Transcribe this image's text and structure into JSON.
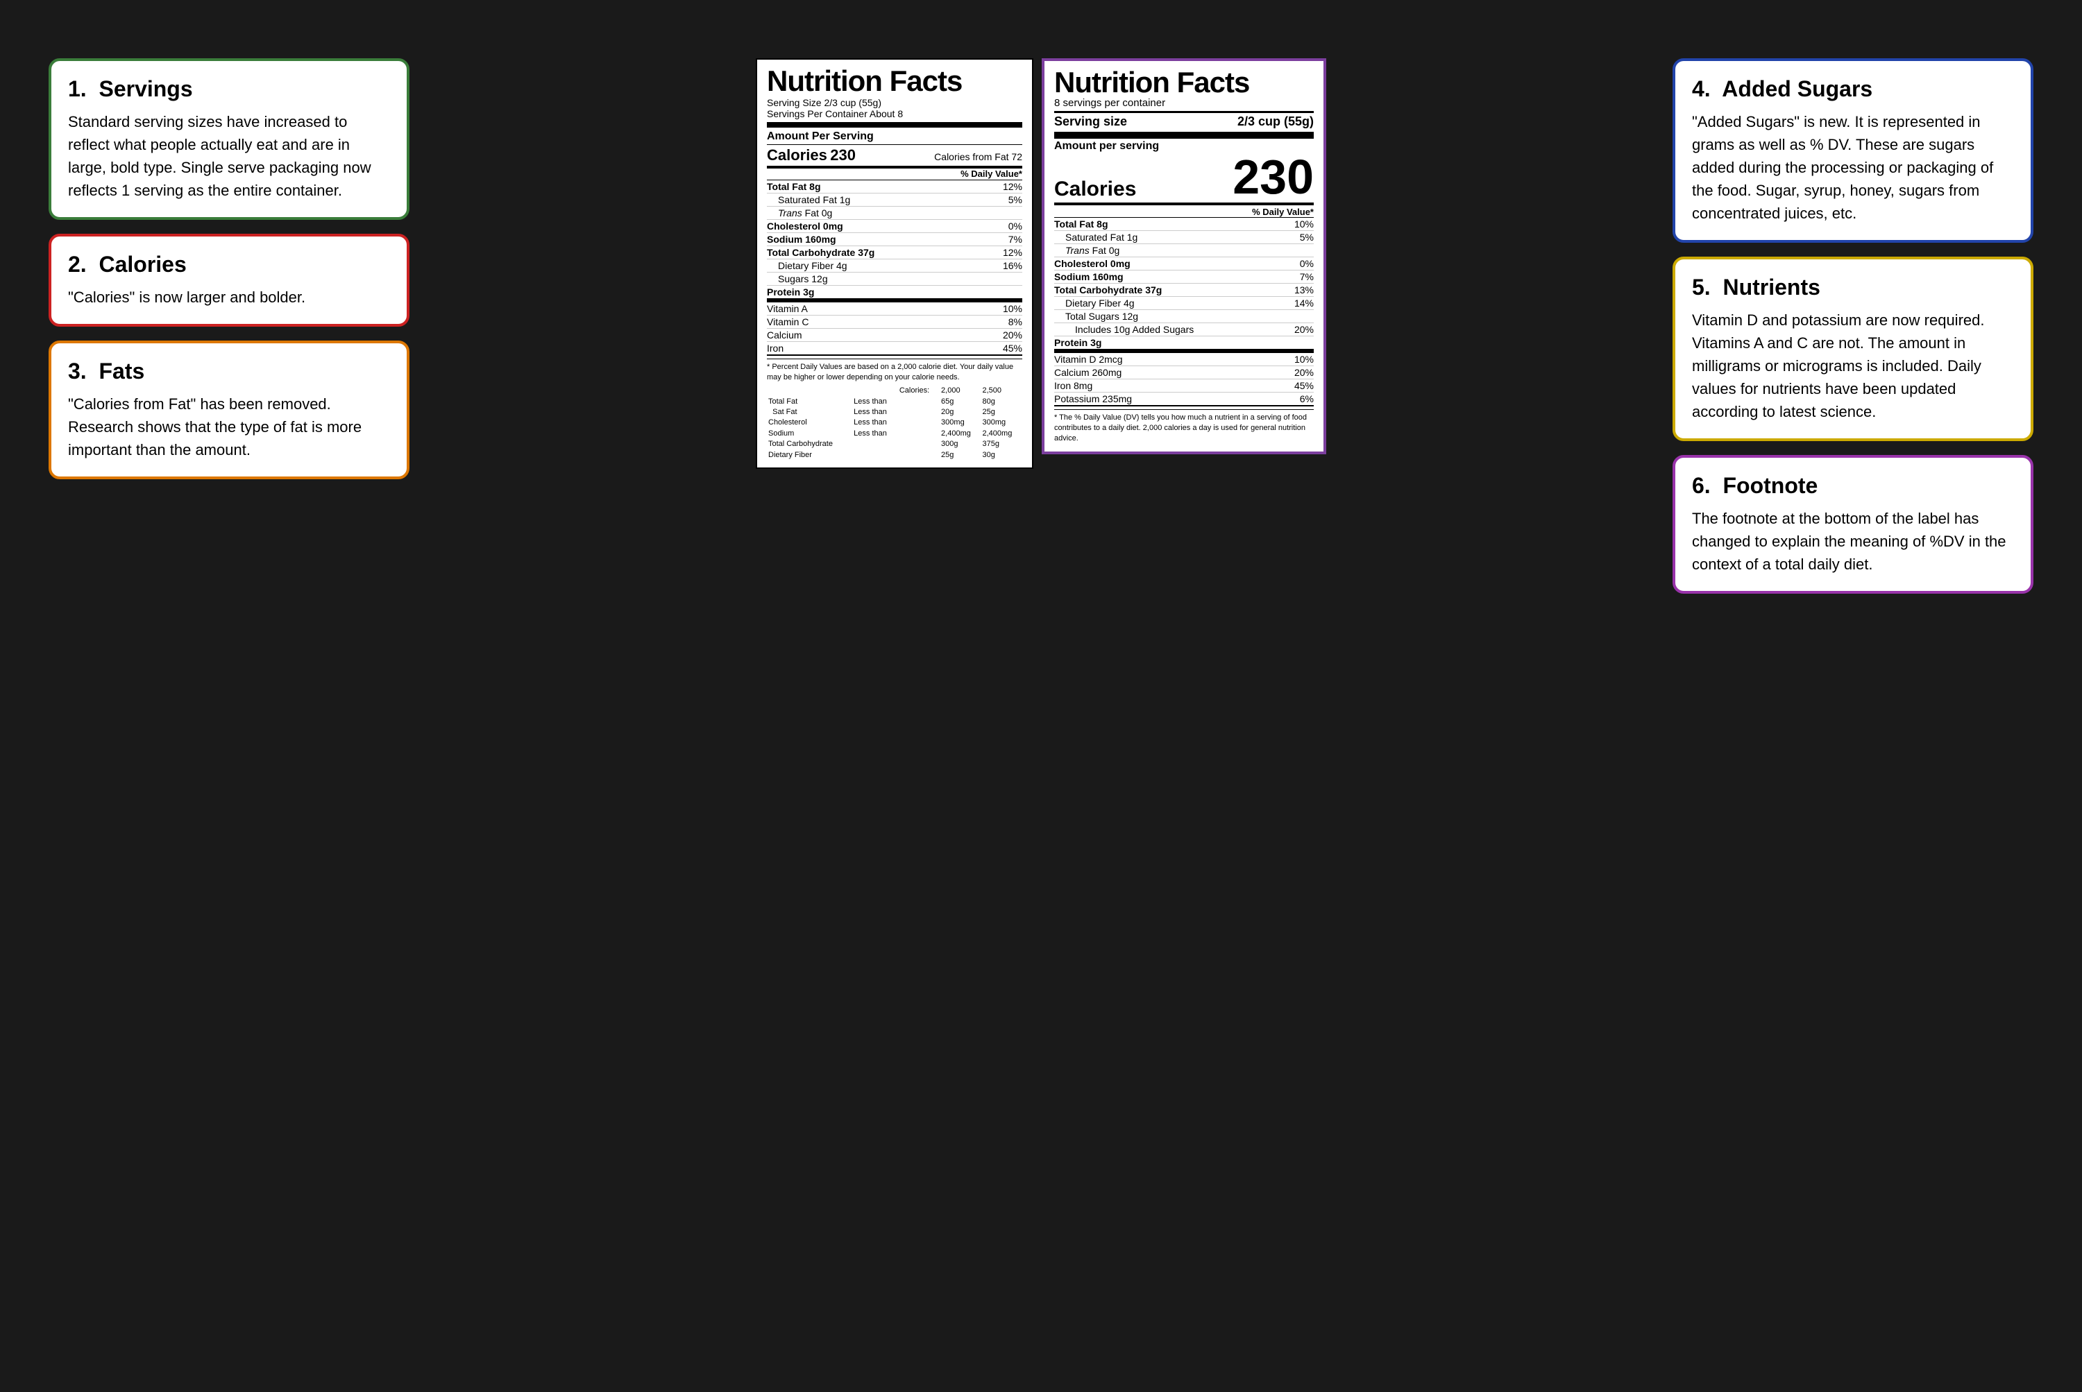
{
  "sections": {
    "servings": {
      "number": "1.",
      "title": "Servings",
      "body": "Standard serving sizes have increased to reflect what people actually eat and are in large, bold type. Single serve packaging now reflects 1 serving as the entire container.",
      "color": "green"
    },
    "calories": {
      "number": "2.",
      "title": "Calories",
      "body": "\"Calories\" is now larger and bolder.",
      "color": "red"
    },
    "fats": {
      "number": "3.",
      "title": "Fats",
      "body": "\"Calories from Fat\" has been removed. Research shows that the type of fat is more important than the amount.",
      "color": "orange"
    },
    "added_sugars": {
      "number": "4.",
      "title": "Added Sugars",
      "body": "\"Added Sugars\" is new. It is represented in grams as well as % DV. These are sugars added during the processing or packaging of the food. Sugar, syrup, honey, sugars from concentrated juices, etc.",
      "color": "blue"
    },
    "nutrients": {
      "number": "5.",
      "title": "Nutrients",
      "body": "Vitamin D and potassium are now required. Vitamins A and C are not. The amount in milligrams or micrograms is included. Daily values for nutrients have been updated according to latest science.",
      "color": "yellow"
    },
    "footnote": {
      "number": "6.",
      "title": "Footnote",
      "body": "The footnote at the bottom of the label has changed to explain the meaning of %DV in the context of a total daily diet.",
      "color": "purple"
    }
  },
  "old_label": {
    "title": "Nutrition Facts",
    "serving_size": "Serving Size 2/3 cup (55g)",
    "servings_per": "Servings Per Container About 8",
    "amount_per_serving": "Amount Per Serving",
    "calories_label": "Calories",
    "calories_value": "230",
    "calories_from_fat": "Calories from Fat 72",
    "daily_value_header": "% Daily Value*",
    "rows": [
      {
        "label": "Total Fat 8g",
        "bold": true,
        "indent": 0,
        "value": "12%"
      },
      {
        "label": "Saturated Fat 1g",
        "bold": false,
        "indent": 1,
        "value": "5%"
      },
      {
        "label": "Trans Fat 0g",
        "bold": false,
        "indent": 1,
        "value": ""
      },
      {
        "label": "Cholesterol 0mg",
        "bold": true,
        "indent": 0,
        "value": "0%"
      },
      {
        "label": "Sodium 160mg",
        "bold": true,
        "indent": 0,
        "value": "7%"
      },
      {
        "label": "Total Carbohydrate 37g",
        "bold": true,
        "indent": 0,
        "value": "12%"
      },
      {
        "label": "Dietary Fiber 4g",
        "bold": false,
        "indent": 1,
        "value": "16%"
      },
      {
        "label": "Sugars 12g",
        "bold": false,
        "indent": 1,
        "value": ""
      },
      {
        "label": "Protein 3g",
        "bold": true,
        "indent": 0,
        "value": ""
      }
    ],
    "vitamins": [
      {
        "label": "Vitamin A",
        "value": "10%"
      },
      {
        "label": "Vitamin C",
        "value": "8%"
      },
      {
        "label": "Calcium",
        "value": "20%"
      },
      {
        "label": "Iron",
        "value": "45%"
      }
    ],
    "footnote_text": "* Percent Daily Values are based on a 2,000 calorie diet. Your daily value may be higher or lower depending on your calorie needs.",
    "footnote_table": {
      "headers": [
        "",
        "",
        "Calories:",
        "2,000",
        "2,500"
      ],
      "rows": [
        [
          "Total Fat",
          "Less than",
          "",
          "65g",
          "80g"
        ],
        [
          "Sat Fat",
          "Less than",
          "",
          "20g",
          "25g"
        ],
        [
          "Cholesterol",
          "Less than",
          "",
          "300mg",
          "300mg"
        ],
        [
          "Sodium",
          "Less than",
          "",
          "2,400mg",
          "2,400mg"
        ],
        [
          "Total Carbohydrate",
          "",
          "",
          "300g",
          "375g"
        ],
        [
          "Dietary Fiber",
          "",
          "",
          "25g",
          "30g"
        ]
      ]
    }
  },
  "new_label": {
    "title": "Nutrition Facts",
    "servings_per": "8 servings per container",
    "serving_size_label": "Serving size",
    "serving_size_value": "2/3 cup (55g)",
    "amount_per_serving": "Amount per serving",
    "calories_label": "Calories",
    "calories_value": "230",
    "daily_value_header": "% Daily Value*",
    "rows": [
      {
        "label": "Total Fat 8g",
        "bold": true,
        "indent": 0,
        "value": "10%"
      },
      {
        "label": "Saturated Fat 1g",
        "bold": false,
        "indent": 1,
        "value": "5%"
      },
      {
        "label": "Trans Fat 0g",
        "bold": false,
        "indent": 1,
        "value": ""
      },
      {
        "label": "Cholesterol 0mg",
        "bold": true,
        "indent": 0,
        "value": "0%"
      },
      {
        "label": "Sodium 160mg",
        "bold": true,
        "indent": 0,
        "value": "7%"
      },
      {
        "label": "Total Carbohydrate 37g",
        "bold": true,
        "indent": 0,
        "value": "13%"
      },
      {
        "label": "Dietary Fiber 4g",
        "bold": false,
        "indent": 1,
        "value": "14%"
      },
      {
        "label": "Total Sugars 12g",
        "bold": false,
        "indent": 1,
        "value": ""
      },
      {
        "label": "Includes 10g Added Sugars",
        "bold": false,
        "indent": 2,
        "value": "20%"
      },
      {
        "label": "Protein 3g",
        "bold": true,
        "indent": 0,
        "value": ""
      }
    ],
    "vitamins": [
      {
        "label": "Vitamin D 2mcg",
        "value": "10%"
      },
      {
        "label": "Calcium 260mg",
        "value": "20%"
      },
      {
        "label": "Iron 8mg",
        "value": "45%"
      },
      {
        "label": "Potassium 235mg",
        "value": "6%"
      }
    ],
    "footnote_text": "* The % Daily Value (DV) tells you how much a nutrient in a serving of food contributes to a daily diet. 2,000 calories a day is used for general nutrition advice."
  }
}
